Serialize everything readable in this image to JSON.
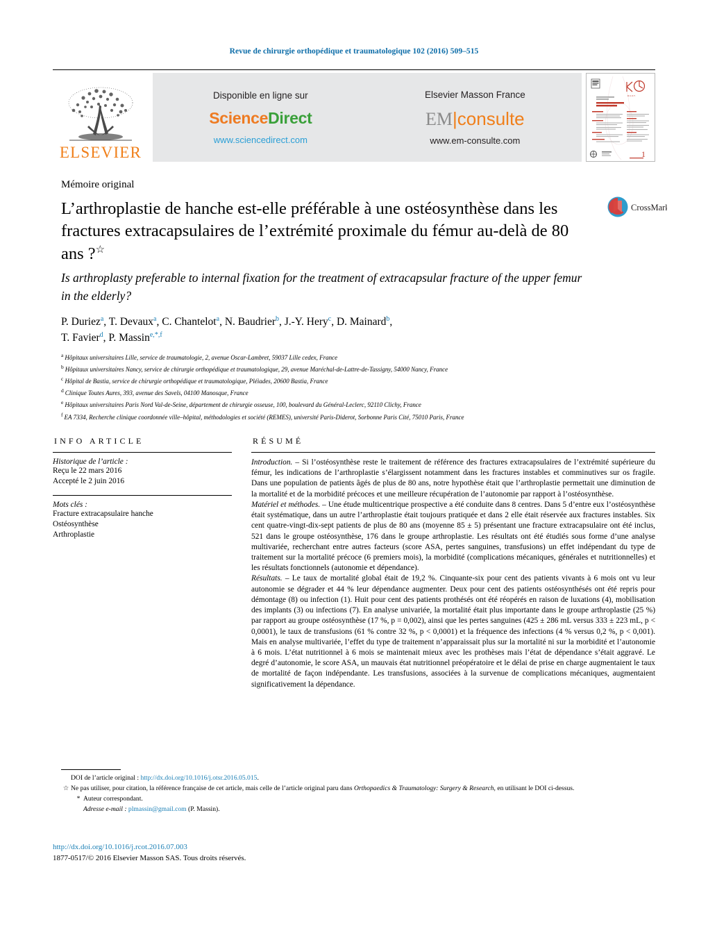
{
  "running_head": "Revue de chirurgie orthopédique et traumatologique 102 (2016) 509–515",
  "masthead": {
    "publisher_wordmark": "ELSEVIER",
    "sciencedirect": {
      "available_label": "Disponible en ligne sur",
      "logo_part1": "Science",
      "logo_part2": "Direct",
      "url": "www.sciencedirect.com"
    },
    "emconsulte": {
      "label": "Elsevier Masson France",
      "logo_part1": "EM",
      "logo_part2": "consulte",
      "url": "www.em-consulte.com"
    }
  },
  "article": {
    "doc_type": "Mémoire original",
    "title_fr": "L’arthroplastie de hanche est-elle préférable à une ostéosynthèse dans les fractures extracapsulaires de l’extrémité proximale du fémur au-delà de 80 ans ?",
    "title_fr_marker": "☆",
    "title_en": "Is arthroplasty preferable to internal fixation for the treatment of extracapsular fracture of the upper femur in the elderly?",
    "authors": "P. Duriez a, T. Devaux a, C. Chantelot a, N. Baudrier b, J.-Y. Hery c, D. Mainard b, T. Favier d, P. Massin e,*,f",
    "author_list": [
      {
        "name": "P. Duriez",
        "marks": "a"
      },
      {
        "name": "T. Devaux",
        "marks": "a"
      },
      {
        "name": "C. Chantelot",
        "marks": "a"
      },
      {
        "name": "N. Baudrier",
        "marks": "b"
      },
      {
        "name": "J.-Y. Hery",
        "marks": "c"
      },
      {
        "name": "D. Mainard",
        "marks": "b"
      },
      {
        "name": "T. Favier",
        "marks": "d"
      },
      {
        "name": "P. Massin",
        "marks": "e,*,f"
      }
    ],
    "affiliations": [
      {
        "mark": "a",
        "text": "Hôpitaux universitaires Lille, service de traumatologie, 2, avenue Oscar-Lambret, 59037 Lille cedex, France"
      },
      {
        "mark": "b",
        "text": "Hôpitaux universitaires Nancy, service de chirurgie orthopédique et traumatologique, 29, avenue Maréchal-de-Lattre-de-Tassigny, 54000 Nancy, France"
      },
      {
        "mark": "c",
        "text": "Hôpital de Bastia, service de chirurgie orthopédique et traumatologique, Pléiades, 20600 Bastia, France"
      },
      {
        "mark": "d",
        "text": "Clinique Toutes Aures, 393, avenue des Savels, 04100 Manosque, France"
      },
      {
        "mark": "e",
        "text": "Hôpitaux universitaires Paris Nord Val-de-Seine, département de chirurgie osseuse, 100, boulevard du Général-Leclerc, 92110 Clichy, France"
      },
      {
        "mark": "f",
        "text": "EA 7334, Recherche clinique coordonnée ville–hôpital, méthodologies et société (REMES), université Paris-Diderot, Sorbonne Paris Cité, 75010 Paris, France"
      }
    ]
  },
  "info_article": {
    "heading": "INFO ARTICLE",
    "history_label": "Historique de l’article :",
    "history_lines": [
      "Reçu le 22 mars 2016",
      "Accepté le 2 juin 2016"
    ],
    "keywords_label": "Mots clés :",
    "keywords": [
      "Fracture extracapsulaire hanche",
      "Ostéosynthèse",
      "Arthroplastie"
    ]
  },
  "abstract": {
    "heading": "RÉSUMÉ",
    "sections": [
      {
        "label": "Introduction.",
        "dash": " – ",
        "text": "Si l’ostéosynthèse reste le traitement de référence des fractures extracapsulaires de l’extrémité supérieure du fémur, les indications de l’arthroplastie s’élargissent notamment dans les fractures instables et comminutives sur os fragile. Dans une population de patients âgés de plus de 80 ans, notre hypothèse était que l’arthroplastie permettait une diminution de la mortalité et de la morbidité précoces et une meilleure récupération de l’autonomie par rapport à l’ostéosynthèse."
      },
      {
        "label": "Matériel et méthodes.",
        "dash": " – ",
        "text": "Une étude multicentrique prospective a été conduite dans 8 centres. Dans 5 d’entre eux l’ostéosynthèse était systématique, dans un autre l’arthroplastie était toujours pratiquée et dans 2 elle était réservée aux fractures instables. Six cent quatre-vingt-dix-sept patients de plus de 80 ans (moyenne 85 ± 5) présentant une fracture extracapsulaire ont été inclus, 521 dans le groupe ostéosynthèse, 176 dans le groupe arthroplastie. Les résultats ont été étudiés sous forme d’une analyse multivariée, recherchant entre autres facteurs (score ASA, pertes sanguines, transfusions) un effet indépendant du type de traitement sur la mortalité précoce (6 premiers mois), la morbidité (complications mécaniques, générales et nutritionnelles) et les résultats fonctionnels (autonomie et dépendance)."
      },
      {
        "label": "Résultats.",
        "dash": " – ",
        "text": "Le taux de mortalité global était de 19,2 %. Cinquante-six pour cent des patients vivants à 6 mois ont vu leur autonomie se dégrader et 44 % leur dépendance augmenter. Deux pour cent des patients ostéosynthésés ont été repris pour démontage (8) ou infection (1). Huit pour cent des patients prothésés ont été réopérés en raison de luxations (4), mobilisation des implants (3) ou infections (7). En analyse univariée, la mortalité était plus importante dans le groupe arthroplastie (25 %) par rapport au groupe ostéosynthèse (17 %, p = 0,002), ainsi que les pertes sanguines (425 ± 286 mL versus 333 ± 223 mL, p < 0,0001), le taux de transfusions (61 % contre 32 %, p < 0,0001) et la fréquence des infections (4 % versus 0,2 %, p < 0,001). Mais en analyse multivariée, l’effet du type de traitement n’apparaissait plus sur la mortalité ni sur la morbidité et l’autonomie à 6 mois. L’état nutritionnel à 6 mois se maintenait mieux avec les prothèses mais l’état de dépendance s’était aggravé. Le degré d’autonomie, le score ASA, un mauvais état nutritionnel préopératoire et le délai de prise en charge augmentaient le taux de mortalité de façon indépendante. Les transfusions, associées à la survenue de complications mécaniques, augmentaient significativement la dépendance."
      }
    ]
  },
  "crossmark": {
    "label": "CrossMark"
  },
  "footnotes": {
    "doi_label": "DOI de l’article original : ",
    "doi_link": "http://dx.doi.org/10.1016/j.otsr.2016.05.015",
    "doi_end": ".",
    "star_mark": "☆",
    "star_text_1": "Ne pas utiliser, pour citation, la référence française de cet article, mais celle de l’article original paru dans ",
    "star_journal": "Orthopaedics & Traumatology: Surgery & Research",
    "star_text_2": ", en utilisant le DOI ci-dessus.",
    "corr_mark": "*",
    "corr_text": "Auteur correspondant.",
    "email_label": "Adresse e-mail : ",
    "email": "plmassin@gmail.com",
    "email_suffix": " (P. Massin)."
  },
  "colophon": {
    "doi": "http://dx.doi.org/10.1016/j.rcot.2016.07.003",
    "copyright": "1877-0517/© 2016 Elsevier Masson SAS. Tous droits réservés."
  },
  "colors": {
    "link": "#1a7fb5",
    "running_head": "#0b6ca8",
    "elsevier_orange": "#f07f1a",
    "sciencedirect_green": "#3aa03a",
    "grey_band": "#e6e7e8"
  }
}
